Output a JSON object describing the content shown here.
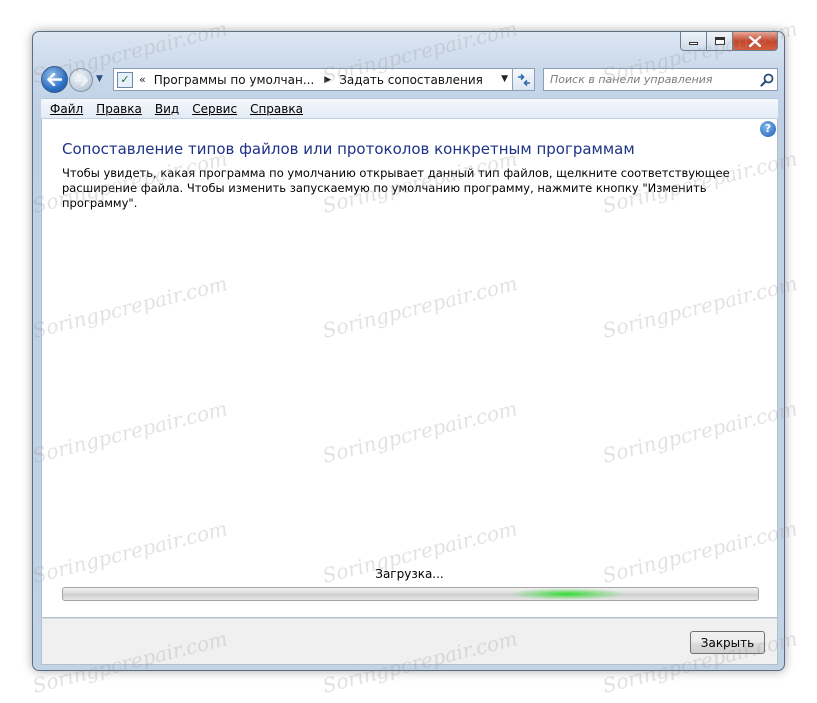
{
  "nav": {
    "breadcrumb_chevron": "«",
    "breadcrumbs": [
      "Программы по умолчан...",
      "Задать сопоставления"
    ],
    "search_placeholder": "Поиск в панели управления"
  },
  "menu": {
    "items": [
      {
        "first": "Ф",
        "rest": "айл"
      },
      {
        "first": "П",
        "rest": "равка"
      },
      {
        "first": "В",
        "rest": "ид"
      },
      {
        "first": "С",
        "rest": "ервис"
      },
      {
        "first": "С",
        "rest": "правка"
      }
    ]
  },
  "main": {
    "title": "Сопоставление типов файлов или протоколов конкретным программам",
    "description": "Чтобы увидеть, какая программа по умолчанию открывает данный тип файлов, щелкните соответствующее расширение файла. Чтобы изменить запускаемую по умолчанию программу, нажмите кнопку \"Изменить программу\".",
    "loading_text": "Загрузка...",
    "progress_indeterminate": true
  },
  "footer": {
    "close_label": "Закрыть"
  },
  "watermark": {
    "text": "Soringpcrepair.com"
  },
  "colors": {
    "title": "#1e3287",
    "progress_glow": "#28dc28",
    "close_button_red": "#c7452a"
  }
}
